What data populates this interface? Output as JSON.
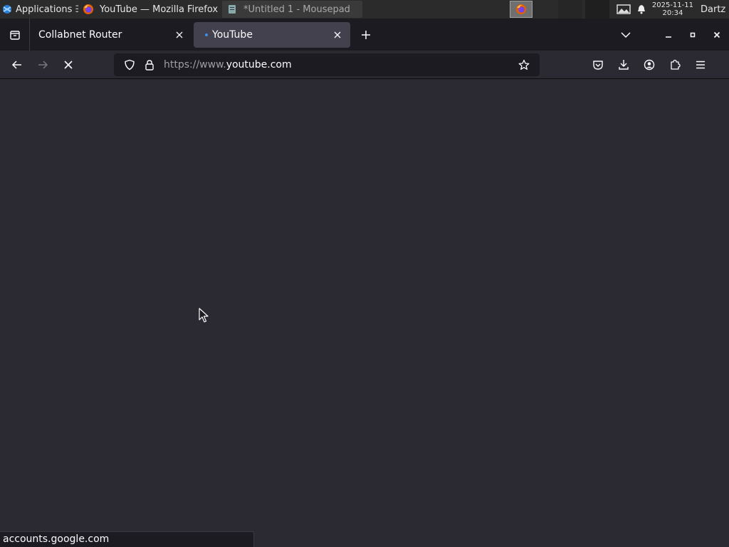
{
  "taskbar": {
    "applications_label": "Applications",
    "tasks": [
      {
        "label": "YouTube — Mozilla Firefox",
        "icon": "firefox-icon",
        "active": true
      },
      {
        "label": "*Untitled 1 - Mousepad",
        "icon": "mousepad-icon",
        "active": false
      }
    ],
    "clock_date": "2025-11-11",
    "clock_time": "20:34",
    "user": "Dartz"
  },
  "browser": {
    "tabs": [
      {
        "label": "Collabnet Router",
        "active": false
      },
      {
        "label": "YouTube",
        "active": true,
        "loading": true
      }
    ],
    "url_protocol": "https://www.",
    "url_host": "youtube.com",
    "status_link": "accounts.google.com"
  },
  "colors": {
    "panel_bg": "#2b2b2b",
    "tabstrip_bg": "#1c1b22",
    "selected_tab_bg": "#42414d",
    "toolbar_bg": "#2b2a33",
    "urlbar_bg": "#1c1b22",
    "content_bg": "#2b2a33",
    "text": "#fbfbfe"
  }
}
